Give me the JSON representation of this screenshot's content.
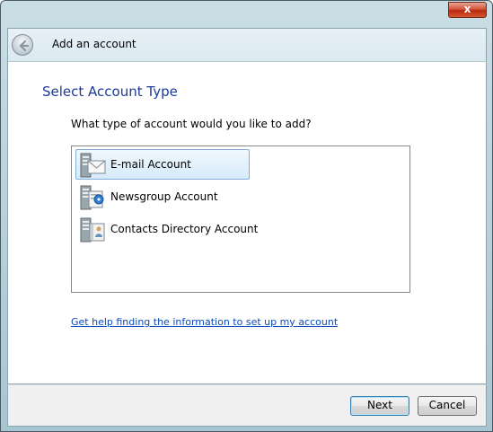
{
  "window": {
    "close_label": "x"
  },
  "header": {
    "title": "Add an account"
  },
  "page": {
    "title": "Select Account Type",
    "prompt": "What type of account would you like to add?"
  },
  "account_types": [
    {
      "label": "E-mail Account",
      "icon": "email-account-icon",
      "selected": true
    },
    {
      "label": "Newsgroup Account",
      "icon": "newsgroup-account-icon",
      "selected": false
    },
    {
      "label": "Contacts Directory Account",
      "icon": "contacts-directory-account-icon",
      "selected": false
    }
  ],
  "help_link": "Get help finding the information to set up my account",
  "buttons": {
    "next": "Next",
    "cancel": "Cancel"
  },
  "colors": {
    "page_title": "#1c3a99",
    "link": "#0b4ab8",
    "selection_border": "#84acdd"
  }
}
